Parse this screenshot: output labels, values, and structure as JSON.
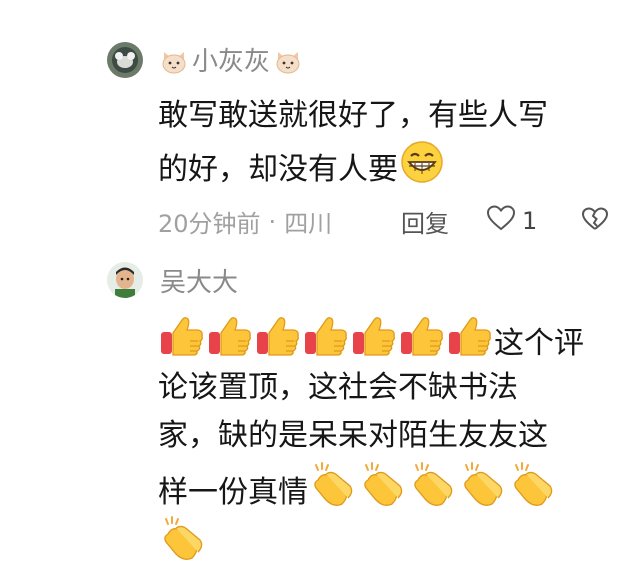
{
  "comments": [
    {
      "username": "小灰灰",
      "text_line1": "敢写敢送就很好了，有些人写",
      "text_line2": "的好，却没有人要",
      "time": "20分钟前",
      "separator": "·",
      "location": "四川",
      "reply_label": "回复",
      "like_count": "1",
      "icons": [
        "cat-face-icon",
        "grinning-face-icon",
        "heart-icon",
        "broken-heart-icon"
      ]
    },
    {
      "username": "吴大大",
      "text_line1": "这个评",
      "text_line2": "论该置顶，这社会不缺书法",
      "text_line3": "家，缺的是呆呆对陌生友友这",
      "text_line4": "样一份真情",
      "icons": [
        "thumbs-up-icon",
        "clapping-hands-icon"
      ]
    }
  ]
}
